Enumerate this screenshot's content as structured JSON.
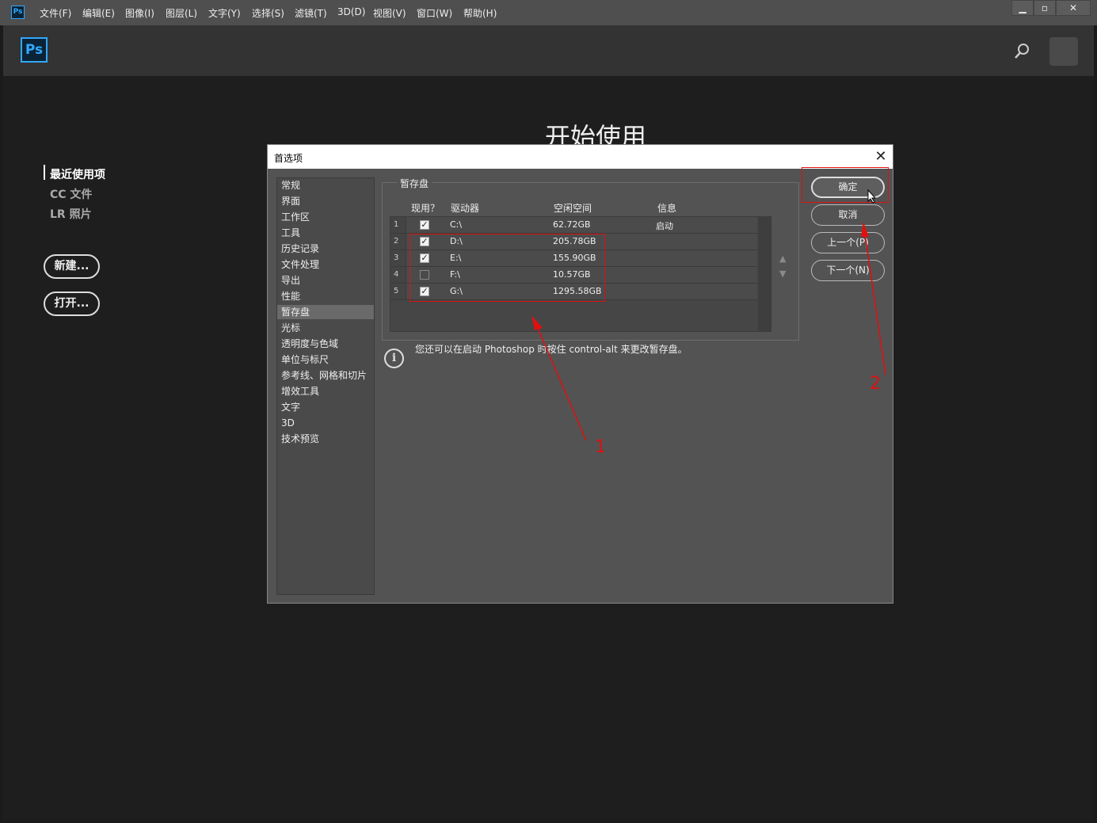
{
  "menubar": {
    "app_icon": "Ps",
    "items": [
      "文件(F)",
      "编辑(E)",
      "图像(I)",
      "图层(L)",
      "文字(Y)",
      "选择(S)",
      "滤镜(T)",
      "3D(D)",
      "视图(V)",
      "窗口(W)",
      "帮助(H)"
    ],
    "window_controls": [
      "minimize-icon",
      "maximize-icon",
      "close-icon"
    ]
  },
  "header": {
    "logo": "Ps",
    "search_icon": "search-icon"
  },
  "home": {
    "title": "开始使用",
    "side_links": [
      "最近使用项",
      "CC 文件",
      "LR 照片"
    ],
    "new_button": "新建...",
    "open_button": "打开..."
  },
  "dialog": {
    "title": "首选项",
    "nav": [
      "常规",
      "界面",
      "工作区",
      "工具",
      "历史记录",
      "文件处理",
      "导出",
      "性能",
      "暂存盘",
      "光标",
      "透明度与色域",
      "单位与标尺",
      "参考线、网格和切片",
      "增效工具",
      "文字",
      "3D",
      "技术预览"
    ],
    "selected_nav": "暂存盘",
    "group_label": "暂存盘",
    "columns": [
      "现用？",
      "驱动器",
      "空闲空间",
      "信息"
    ],
    "rows": [
      {
        "num": "1",
        "active": true,
        "drive": "C:\\",
        "space": "62.72GB",
        "info": "启动"
      },
      {
        "num": "2",
        "active": true,
        "drive": "D:\\",
        "space": "205.78GB",
        "info": ""
      },
      {
        "num": "3",
        "active": true,
        "drive": "E:\\",
        "space": "155.90GB",
        "info": ""
      },
      {
        "num": "4",
        "active": false,
        "drive": "F:\\",
        "space": "10.57GB",
        "info": ""
      },
      {
        "num": "5",
        "active": true,
        "drive": "G:\\",
        "space": "1295.58GB",
        "info": ""
      }
    ],
    "info_text": "您还可以在启动 Photoshop 时按住 control-alt 来更改暂存盘。",
    "buttons": {
      "ok": "确定",
      "cancel": "取消",
      "prev": "上一个(P)",
      "next": "下一个(N)"
    }
  },
  "annotations": {
    "label_1": "1",
    "label_2": "2",
    "color": "#e01010"
  }
}
